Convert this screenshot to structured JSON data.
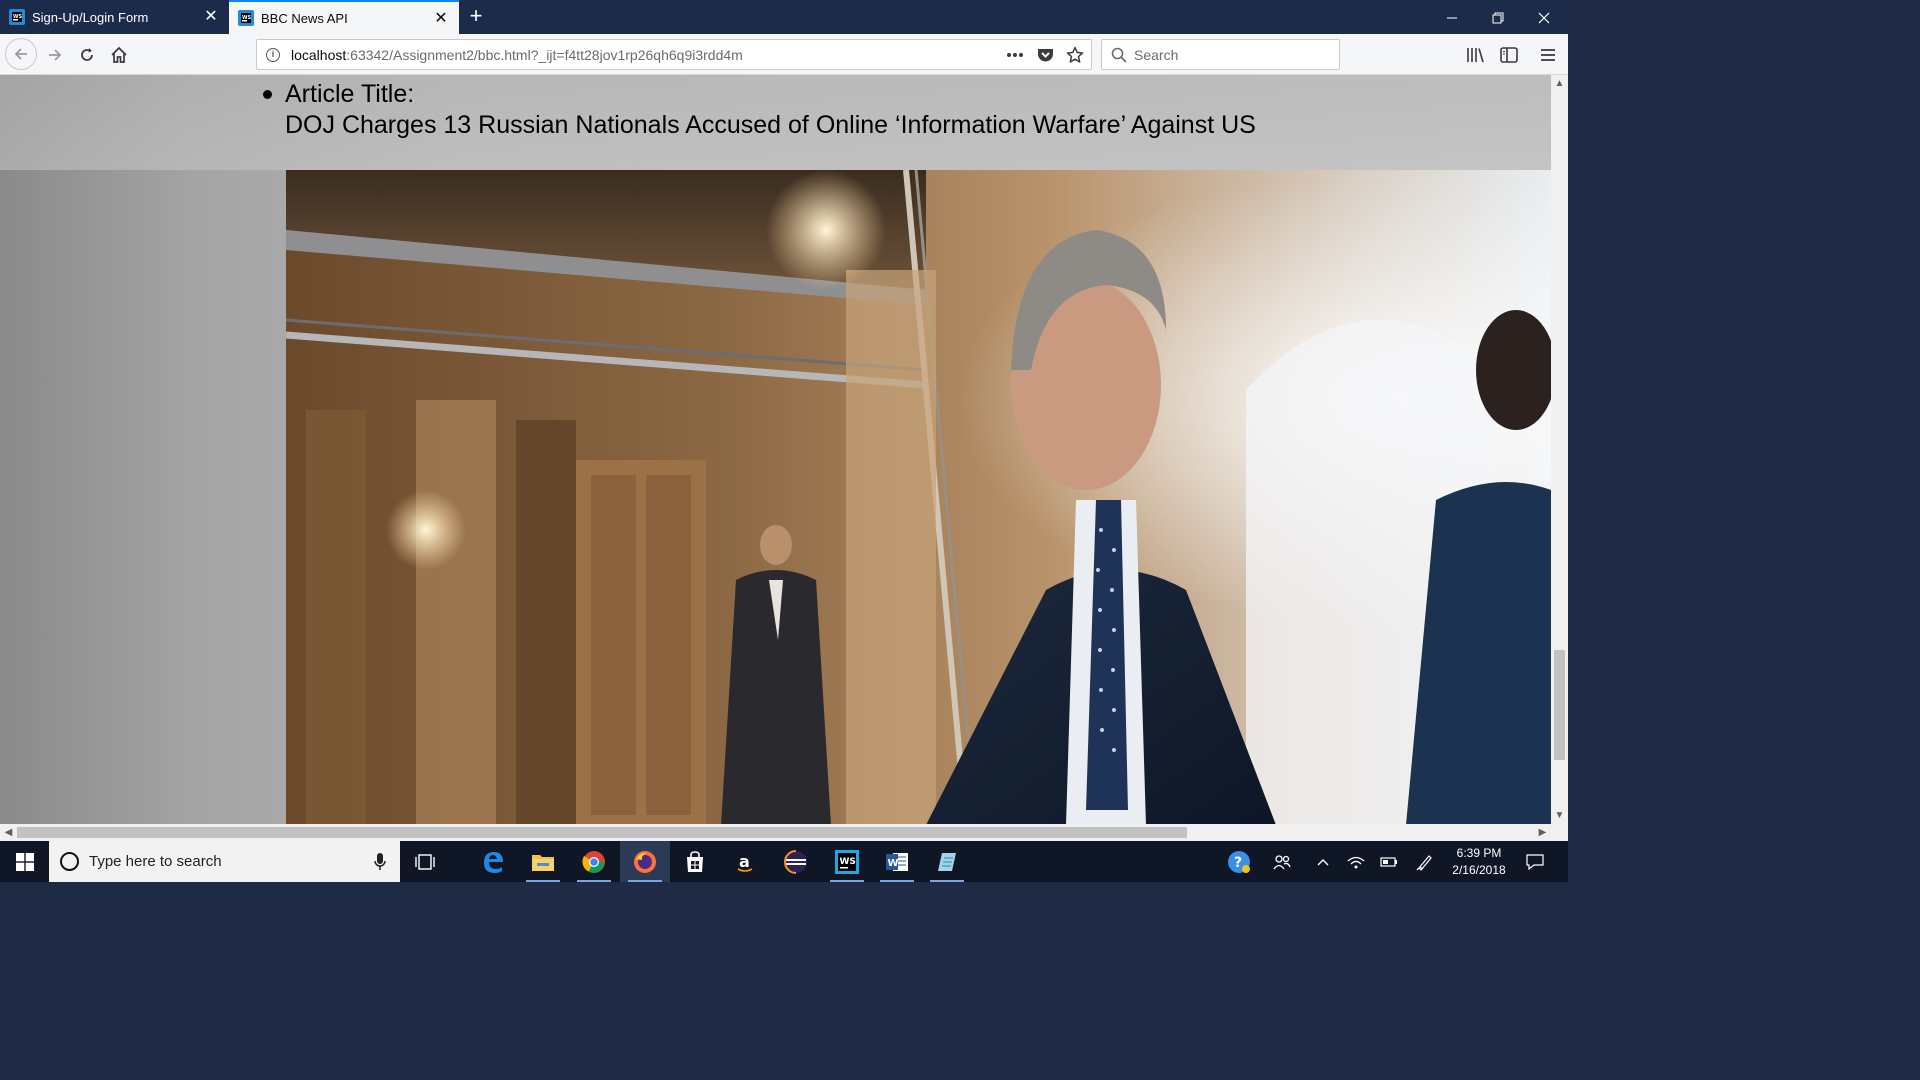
{
  "browser": {
    "tabs": [
      {
        "title": "Sign-Up/Login Form",
        "active": false
      },
      {
        "title": "BBC News API",
        "active": true
      }
    ],
    "url_host": "localhost",
    "url_rest": ":63342/Assignment2/bbc.html?_ijt=f4tt28jov1rp26qh6q9i3rdd4m",
    "search_placeholder": "Search"
  },
  "page": {
    "article_label": "Article Title:",
    "article_title": "DOJ Charges 13 Russian Nationals Accused of Online ‘Information Warfare’ Against US"
  },
  "taskbar": {
    "search_placeholder": "Type here to search",
    "time": "6:39 PM",
    "date": "2/16/2018",
    "apps": [
      "task-view",
      "edge",
      "file-explorer",
      "chrome",
      "firefox",
      "store",
      "amazon",
      "eclipse",
      "webstorm",
      "word",
      "notepad"
    ]
  }
}
